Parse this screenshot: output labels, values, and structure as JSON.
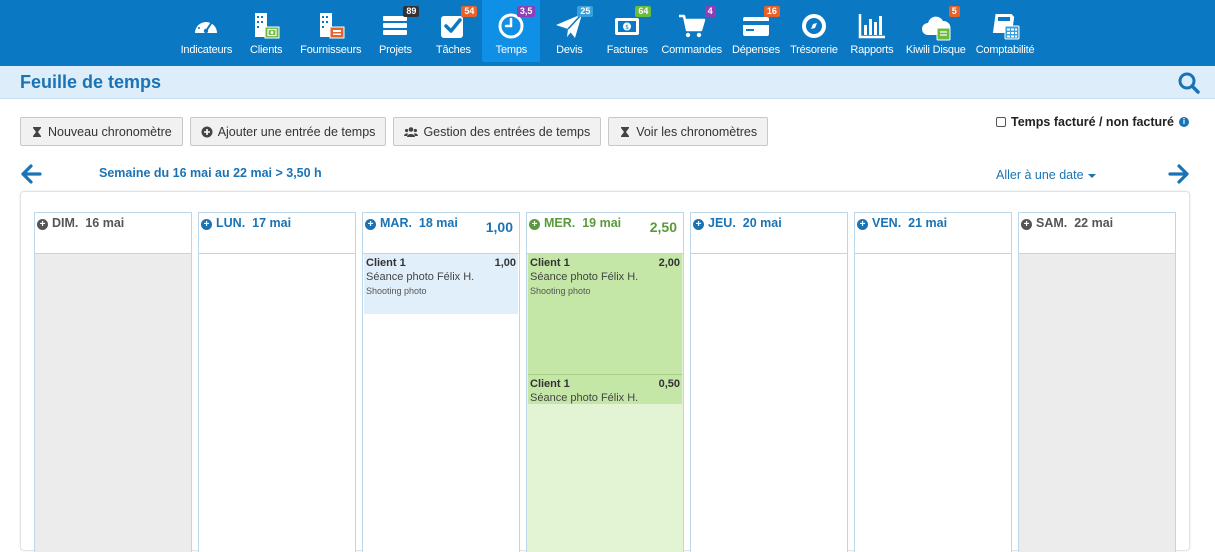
{
  "nav": {
    "items": [
      {
        "label": "Indicateurs",
        "icon": "gauge-icon",
        "badge": "",
        "badge_color": ""
      },
      {
        "label": "Clients",
        "icon": "clients-building-icon",
        "badge": "",
        "badge_color": ""
      },
      {
        "label": "Fournisseurs",
        "icon": "suppliers-building-icon",
        "badge": "",
        "badge_color": ""
      },
      {
        "label": "Projets",
        "icon": "projects-stack-icon",
        "badge": "89",
        "badge_color": "#333333"
      },
      {
        "label": "Tâches",
        "icon": "tasks-check-icon",
        "badge": "54",
        "badge_color": "#e8632c"
      },
      {
        "label": "Temps",
        "icon": "clock-icon",
        "badge": "3,5",
        "badge_color": "#8e3fb8"
      },
      {
        "label": "Devis",
        "icon": "paper-plane-icon",
        "badge": "25",
        "badge_color": "#3aa0d9"
      },
      {
        "label": "Factures",
        "icon": "invoice-money-icon",
        "badge": "64",
        "badge_color": "#6cba3e"
      },
      {
        "label": "Commandes",
        "icon": "cart-icon",
        "badge": "4",
        "badge_color": "#8e3fb8"
      },
      {
        "label": "Dépenses",
        "icon": "credit-card-icon",
        "badge": "16",
        "badge_color": "#e8632c"
      },
      {
        "label": "Trésorerie",
        "icon": "compass-icon",
        "badge": "",
        "badge_color": ""
      },
      {
        "label": "Rapports",
        "icon": "bar-chart-icon",
        "badge": "",
        "badge_color": ""
      },
      {
        "label": "Kiwili Disque",
        "icon": "cloud-icon",
        "badge": "5",
        "badge_color": "#e8632c"
      },
      {
        "label": "Comptabilité",
        "icon": "calculator-icon",
        "badge": "",
        "badge_color": ""
      }
    ],
    "active_index": 5
  },
  "header": {
    "title": "Feuille de temps"
  },
  "toolbar": {
    "new_timer": "Nouveau chronomètre",
    "add_entry": "Ajouter une entrée de temps",
    "manage_entries": "Gestion des entrées de temps",
    "view_timers": "Voir les chronomètres"
  },
  "billed_toggle": {
    "label": "Temps facturé / non facturé"
  },
  "week": {
    "label": "Semaine du 16 mai au 22 mai > 3,50 h",
    "goto_date": "Aller à une date"
  },
  "colors": {
    "brand": "#0a78c2",
    "link": "#1a73b5",
    "green": "#5a9a3a",
    "entry_blue": "#e1effb",
    "entry_green": "#c4e6a6",
    "entry_green_light": "#e3f4d4",
    "weekend_grey": "#555555"
  },
  "days": [
    {
      "name": "DIM.",
      "date": "16 mai",
      "total": "",
      "weekend": true,
      "fill": "",
      "entries": []
    },
    {
      "name": "LUN.",
      "date": "17 mai",
      "total": "",
      "weekend": false,
      "fill": "",
      "entries": []
    },
    {
      "name": "MAR.",
      "date": "18 mai",
      "total": "1,00",
      "weekend": false,
      "fill": "",
      "entries": [
        {
          "client": "Client 1",
          "hours": "1,00",
          "desc": "Séance photo Félix H.",
          "note": "Shooting photo",
          "color": "#e1effb"
        }
      ]
    },
    {
      "name": "MER.",
      "date": "19 mai",
      "total": "2,50",
      "weekend": false,
      "fill": "#e3f4d4",
      "entries": [
        {
          "client": "Client 1",
          "hours": "2,00",
          "desc": "Séance photo Félix H.",
          "note": "Shooting photo",
          "color": "#c4e6a6"
        },
        {
          "client": "Client 1",
          "hours": "0,50",
          "desc": "Séance photo Félix H.",
          "note": "",
          "color": "#c4e6a6"
        }
      ]
    },
    {
      "name": "JEU.",
      "date": "20 mai",
      "total": "",
      "weekend": false,
      "fill": "",
      "entries": []
    },
    {
      "name": "VEN.",
      "date": "21 mai",
      "total": "",
      "weekend": false,
      "fill": "",
      "entries": []
    },
    {
      "name": "SAM.",
      "date": "22 mai",
      "total": "",
      "weekend": true,
      "fill": "",
      "entries": []
    }
  ]
}
